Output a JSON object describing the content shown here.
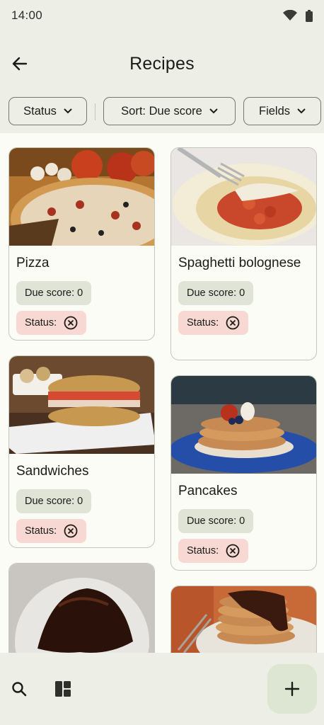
{
  "status_bar": {
    "time": "14:00",
    "icons": [
      "wifi-icon",
      "battery-icon"
    ]
  },
  "app_bar": {
    "title": "Recipes",
    "back_icon": "arrow-back-icon"
  },
  "filters": {
    "status_label": "Status",
    "sort_label": "Sort: Due score",
    "fields_label": "Fields"
  },
  "recipes": [
    {
      "name": "Pizza",
      "due_label": "Due score: 0",
      "status_label": "Status:"
    },
    {
      "name": "Spaghetti bolognese",
      "due_label": "Due score: 0",
      "status_label": "Status:"
    },
    {
      "name": "Sandwiches",
      "due_label": "Due score: 0",
      "status_label": "Status:"
    },
    {
      "name": "Pancakes",
      "due_label": "Due score: 0",
      "status_label": "Status:"
    }
  ],
  "bottom_bar": {
    "icons": [
      "search-icon",
      "layout-icon"
    ],
    "fab_icon": "add-icon"
  },
  "colors": {
    "background": "#fbfcf5",
    "surface_container": "#edefe6",
    "due_badge": "#dfe4d7",
    "status_badge": "#f7d8d2",
    "fab": "#dce6d3"
  }
}
